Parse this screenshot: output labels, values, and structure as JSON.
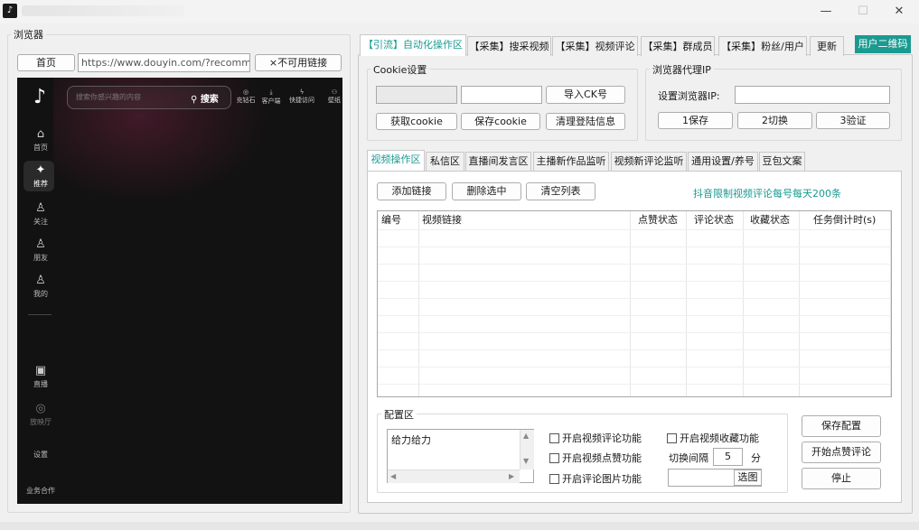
{
  "titlebar": {
    "logo": "♪",
    "min": "—",
    "max": "☐",
    "close": "✕"
  },
  "browser": {
    "group_label": "浏览器",
    "home_btn": "首页",
    "url": "https://www.douyin.com/?recommen",
    "bad_link_btn": "×不可用链接",
    "douyin": {
      "search_placeholder": "搜索你感兴趣的内容",
      "search_btn": "搜索",
      "top_icons": [
        "充钻石",
        "客户端",
        "快捷访问",
        "壁纸"
      ],
      "side": [
        {
          "label": "首页",
          "icon": "⌂"
        },
        {
          "label": "推荐",
          "icon": "✦"
        },
        {
          "label": "关注",
          "icon": "♙"
        },
        {
          "label": "朋友",
          "icon": "♙"
        },
        {
          "label": "我的",
          "icon": "♙"
        },
        {
          "label": "直播",
          "icon": "▣"
        },
        {
          "label": "放映厅",
          "icon": "◎"
        },
        {
          "label": "设置",
          "icon": ""
        },
        {
          "label": "业务合作",
          "icon": ""
        }
      ]
    }
  },
  "top_tabs": [
    {
      "label": "【引流】自动化操作区",
      "active": true
    },
    {
      "label": "【采集】搜采视频"
    },
    {
      "label": "【采集】视频评论"
    },
    {
      "label": "【采集】群成员"
    },
    {
      "label": "【采集】粉丝/用户"
    },
    {
      "label": "更新"
    }
  ],
  "qr_btn": "用户二维码",
  "cookie": {
    "group_label": "Cookie设置",
    "import_btn": "导入CK号",
    "get_btn": "获取cookie",
    "save_btn": "保存cookie",
    "clear_btn": "清理登陆信息"
  },
  "proxy": {
    "group_label": "浏览器代理IP",
    "ip_label": "设置浏览器IP:",
    "save_btn": "1保存",
    "switch_btn": "2切换",
    "verify_btn": "3验证"
  },
  "sub_tabs": [
    {
      "label": "视频操作区",
      "active": true
    },
    {
      "label": "私信区"
    },
    {
      "label": "直播间发言区"
    },
    {
      "label": "主播新作品监听"
    },
    {
      "label": "视频新评论监听"
    },
    {
      "label": "通用设置/养号"
    },
    {
      "label": "豆包文案"
    }
  ],
  "video_ops": {
    "add_btn": "添加链接",
    "del_btn": "删除选中",
    "clear_btn": "清空列表",
    "limit_note": "抖音限制视频评论每号每天200条",
    "columns": [
      "编号",
      "视频链接",
      "点赞状态",
      "评论状态",
      "收藏状态",
      "任务倒计时(s)"
    ]
  },
  "config": {
    "group_label": "配置区",
    "textarea": "给力给力",
    "chk_comment": "开启视频评论功能",
    "chk_like": "开启视频点赞功能",
    "chk_image": "开启评论图片功能",
    "chk_fav": "开启视频收藏功能",
    "interval_label": "切换间隔",
    "interval_value": "5",
    "interval_unit": "分",
    "choose_btn": "选图",
    "save_cfg_btn": "保存配置",
    "start_btn": "开始点赞评论",
    "stop_btn": "停止"
  },
  "colors": {
    "accent": "#1a9a91",
    "qr_bg": "#1a9a91",
    "note": "#1a9a91"
  }
}
